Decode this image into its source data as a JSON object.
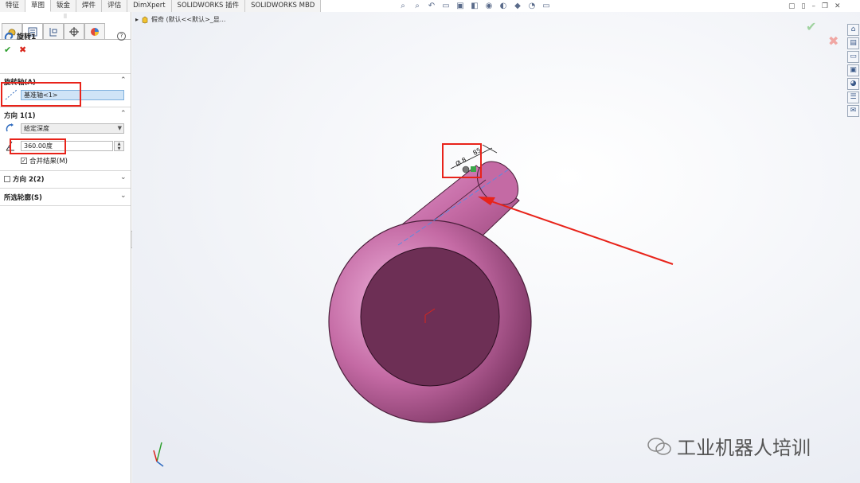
{
  "tabs": [
    "特征",
    "草图",
    "钣金",
    "焊件",
    "评估",
    "DimXpert",
    "SOLIDWORKS 插件",
    "SOLIDWORKS MBD"
  ],
  "active_tab": 1,
  "feature": {
    "name": "旋转1"
  },
  "sections": {
    "axis": {
      "title": "旋转轴(A)",
      "value": "基准轴<1>"
    },
    "direction1": {
      "title": "方向 1(1)",
      "end_condition": "给定深度",
      "angle": "360.00度",
      "merge_label": "合并结果(M)",
      "merge_checked": true
    },
    "direction2": {
      "title": "方向 2(2)"
    },
    "contours": {
      "title": "所选轮廓(S)"
    }
  },
  "breadcrumb": "假奇 (默认<<默认>_显...",
  "dimensions": {
    "diameter": "Ø 8",
    "length": "85"
  },
  "watermark": "工业机器人培训",
  "colors": {
    "part": "#c46aa4",
    "face": "#6d2f55",
    "annotation_red": "#e8231a",
    "accept_green": "#2a9d2a"
  },
  "icons": {
    "pm_tabs": [
      "feature-manager-icon",
      "property-manager-icon",
      "configuration-manager-icon",
      "dimxpert-icon",
      "display-manager-icon"
    ],
    "taskpane": [
      "home-icon",
      "parts-library-icon",
      "file-explorer-icon",
      "view-palette-icon",
      "appearances-icon",
      "custom-properties-icon",
      "forum-icon"
    ]
  }
}
